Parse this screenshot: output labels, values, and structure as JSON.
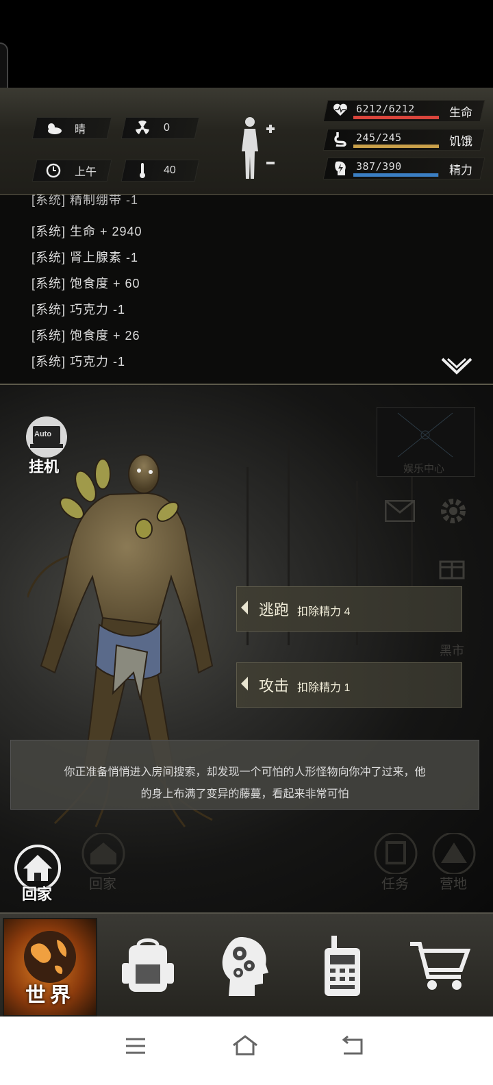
{
  "environment": {
    "weather": "晴",
    "radiation": "0",
    "time_of_day": "上午",
    "temperature": "40"
  },
  "stats": [
    {
      "label": "生命",
      "value": "6212/6212",
      "fill": 1.0,
      "color": "#d9453c",
      "icon": "heart-pulse-icon"
    },
    {
      "label": "饥饿",
      "value": "245/245",
      "fill": 1.0,
      "color": "#c9a04a",
      "icon": "stomach-icon"
    },
    {
      "label": "精力",
      "value": "387/390",
      "fill": 0.99,
      "color": "#3b7fc4",
      "icon": "lightning-head-icon"
    }
  ],
  "log": {
    "partial_top": "[系统] 精制绷带 -1",
    "lines": [
      "[系统] 生命 + 2940",
      "[系统] 肾上腺素 -1",
      "[系统] 饱食度 + 60",
      "[系统] 巧克力 -1",
      "[系统] 饱食度 + 26",
      "[系统] 巧克力 -1"
    ]
  },
  "scene": {
    "auto_label": "Auto",
    "idle_label": "挂机",
    "entertainment_label": "娱乐中心",
    "black_market_label": "黑市",
    "actions": [
      {
        "label": "逃跑",
        "cost": "扣除精力 4"
      },
      {
        "label": "攻击",
        "cost": "扣除精力 1"
      }
    ],
    "message_line1": "你正准备悄悄进入房间搜索，却发现一个可怕的人形怪物向你冲了过来，他",
    "message_line2": "的身上布满了变异的藤蔓，看起来非常可怕",
    "home_label": "回家",
    "bg_home_label": "回家",
    "bg_task_label": "任务",
    "bg_camp_label": "营地"
  },
  "bottom_nav": {
    "world_label": "世界",
    "items": [
      "world-globe-icon",
      "backpack-icon",
      "brain-gears-icon",
      "walkie-talkie-icon",
      "shopping-cart-icon"
    ]
  }
}
